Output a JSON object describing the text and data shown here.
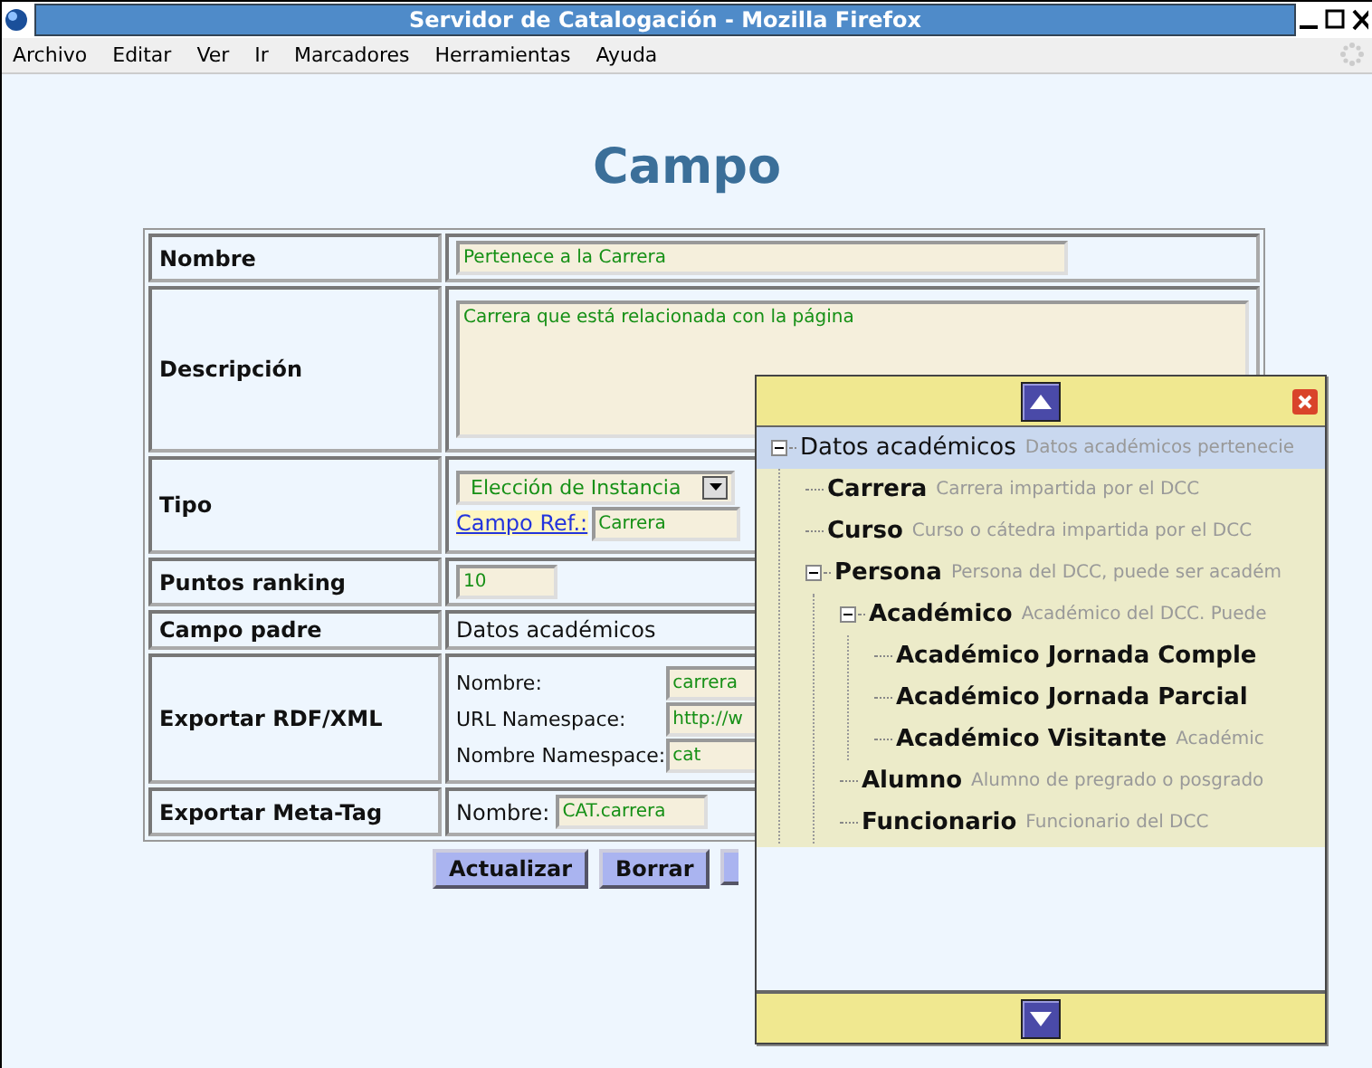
{
  "window": {
    "title": "Servidor de Catalogación - Mozilla Firefox"
  },
  "menu": [
    "Archivo",
    "Editar",
    "Ver",
    "Ir",
    "Marcadores",
    "Herramientas",
    "Ayuda"
  ],
  "page": {
    "heading": "Campo"
  },
  "form": {
    "rows": [
      {
        "kind": "text",
        "label": "Nombre",
        "value": "Pertenece a la Carrera"
      },
      {
        "kind": "textarea",
        "label": "Descripción",
        "value": "Carrera que está relacionada con la página"
      },
      {
        "kind": "type",
        "label": "Tipo",
        "select": "Elección de Instancia",
        "link": "Campo Ref.:",
        "value": "Carrera"
      },
      {
        "kind": "short",
        "label": "Puntos ranking",
        "value": "10"
      },
      {
        "kind": "static",
        "label": "Campo padre",
        "value": "Datos académicos"
      },
      {
        "kind": "fields",
        "label": "Exportar RDF/XML",
        "fields": [
          {
            "label": "Nombre:",
            "value": "carrera"
          },
          {
            "label": "URL Namespace:",
            "value": "http://w"
          },
          {
            "label": "Nombre Namespace:",
            "value": "cat"
          }
        ]
      },
      {
        "kind": "inline",
        "label": "Exportar Meta-Tag",
        "fields": [
          {
            "label": "Nombre:",
            "value": "CAT.carrera"
          }
        ]
      }
    ]
  },
  "buttons": [
    {
      "label": "Actualizar"
    },
    {
      "label": "Borrar"
    },
    {
      "covered": true
    }
  ],
  "popup": {
    "tree": [
      {
        "label": "Datos académicos",
        "description": "Datos académicos pertenecie",
        "selected": true,
        "expanded": true,
        "children": [
          {
            "label": "Carrera",
            "description": "Carrera impartida por el DCC",
            "selected": false
          },
          {
            "label": "Curso",
            "description": "Curso o cátedra impartida por el DCC",
            "selected": false
          },
          {
            "label": "Persona",
            "description": "Persona del DCC, puede ser académ",
            "selected": false,
            "expanded": true,
            "children": [
              {
                "label": "Académico",
                "description": "Académico del DCC. Puede",
                "selected": false,
                "expanded": true,
                "children": [
                  {
                    "label": "Académico Jornada Comple",
                    "selected": false
                  },
                  {
                    "label": "Académico Jornada Parcial",
                    "selected": false
                  },
                  {
                    "label": "Académico Visitante",
                    "description": "Académic",
                    "selected": false
                  }
                ]
              },
              {
                "label": "Alumno",
                "description": "Alumno de pregrado o posgrado",
                "selected": false
              },
              {
                "label": "Funcionario",
                "description": "Funcionario del DCC",
                "selected": false
              }
            ]
          }
        ]
      }
    ]
  }
}
